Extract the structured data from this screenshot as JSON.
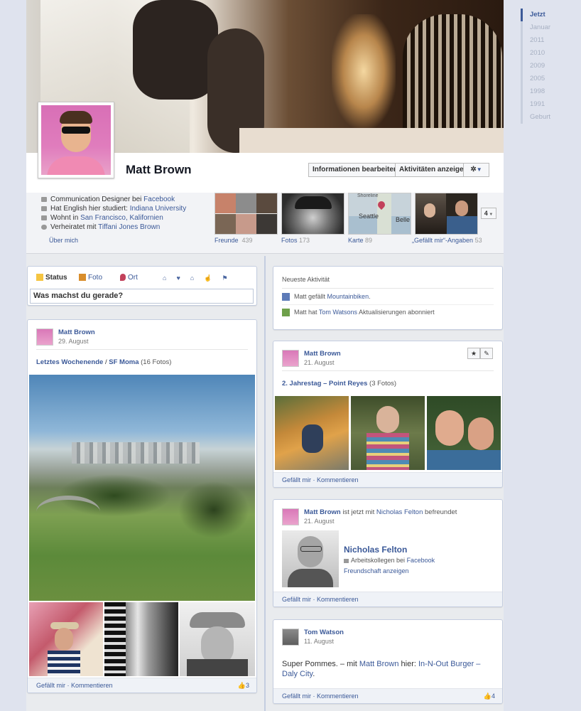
{
  "profile": {
    "name": "Matt Brown",
    "edit_button": "Informationen bearbeiten",
    "activity_button": "Aktivitäten anzeigen",
    "gear_label": "✲"
  },
  "info": {
    "work_prefix": "Communication Designer bei ",
    "work_link": "Facebook",
    "study_prefix": "Hat English hier studiert: ",
    "study_link": "Indiana University",
    "live_prefix": "Wohnt in ",
    "live_link": "San Francisco, Kalifornien",
    "married_prefix": "Verheiratet mit ",
    "married_link": "Tiffani Jones Brown",
    "about_link": "Über mich"
  },
  "tiles": {
    "friends": {
      "label": "Freunde",
      "count": "439"
    },
    "photos": {
      "label": "Fotos",
      "count": "173"
    },
    "map": {
      "label": "Karte",
      "count": "89",
      "place1": "Seattle",
      "place2": "Belle",
      "place3": "Shoreline"
    },
    "likes": {
      "label": "„Gefällt mir“-Angaben",
      "count": "53"
    },
    "more": "4"
  },
  "composer": {
    "status": "Status",
    "photo": "Foto",
    "place": "Ort",
    "placeholder": "Was machst du gerade?"
  },
  "activity": {
    "title": "Neueste Aktivität",
    "item1_prefix": "Matt gefällt ",
    "item1_link": "Mountainbiken",
    "item1_suffix": ".",
    "item2_prefix": "Matt hat ",
    "item2_link": "Tom Watsons",
    "item2_suffix": " Aktualisierungen abonniert"
  },
  "post1": {
    "author": "Matt Brown",
    "date": "29. August",
    "album1": "Letztes Wochenende",
    "sep": " / ",
    "album2": "SF Moma",
    "count": " (16 Fotos)",
    "actions": "Gefällt mir · Kommentieren",
    "likes": "3"
  },
  "post2": {
    "author": "Matt Brown",
    "date": "21. August",
    "album": "2. Jahrestag – Point Reyes",
    "count": " (3 Fotos)",
    "actions": "Gefällt mir · Kommentieren"
  },
  "post3": {
    "author": "Matt Brown",
    "middle": " ist jetzt mit ",
    "friend": "Nicholas Felton",
    "suffix": " befreundet",
    "date": "21. August",
    "card_name": "Nicholas Felton",
    "card_prefix": "Arbeitskollegen bei ",
    "card_link": "Facebook",
    "card_action": "Freundschaft anzeigen",
    "actions": "Gefällt mir · Kommentieren"
  },
  "post4": {
    "author": "Tom Watson",
    "date": "11. August",
    "text_prefix": "Super Pommes. – mit ",
    "text_link1": "Matt Brown",
    "text_middle": " hier: ",
    "text_link2": "In-N-Out Burger – Daly City",
    "text_suffix": ".",
    "actions": "Gefällt mir · Kommentieren",
    "likes": "4"
  },
  "years": [
    "Jetzt",
    "Januar",
    "2011",
    "2010",
    "2009",
    "2005",
    "1998",
    "1991",
    "Geburt"
  ]
}
